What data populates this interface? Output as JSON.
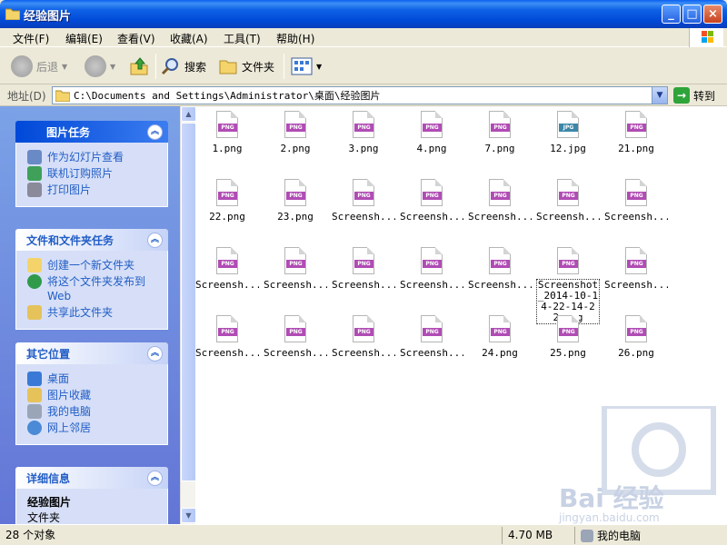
{
  "window": {
    "title": "经验图片",
    "min_label": "_",
    "max_label": "□",
    "close_label": "×"
  },
  "menu": {
    "items": [
      "文件(F)",
      "编辑(E)",
      "查看(V)",
      "收藏(A)",
      "工具(T)",
      "帮助(H)"
    ]
  },
  "toolbar": {
    "back_label": "后退",
    "search_label": "搜索",
    "folders_label": "文件夹"
  },
  "address": {
    "label": "地址(D)",
    "path": "C:\\Documents and Settings\\Administrator\\桌面\\经验图片",
    "go_label": "转到"
  },
  "sidebar": {
    "picture_tasks": {
      "title": "图片任务",
      "items": [
        "作为幻灯片查看",
        "联机订购照片",
        "打印图片"
      ]
    },
    "file_tasks": {
      "title": "文件和文件夹任务",
      "items": [
        "创建一个新文件夹",
        "将这个文件夹发布到 Web",
        "共享此文件夹"
      ]
    },
    "other_places": {
      "title": "其它位置",
      "items": [
        "桌面",
        "图片收藏",
        "我的电脑",
        "网上邻居"
      ]
    },
    "details": {
      "title": "详细信息",
      "name": "经验图片",
      "type": "文件夹"
    }
  },
  "files": [
    {
      "name": "1.png",
      "type": "PNG"
    },
    {
      "name": "2.png",
      "type": "PNG"
    },
    {
      "name": "3.png",
      "type": "PNG"
    },
    {
      "name": "4.png",
      "type": "PNG"
    },
    {
      "name": "7.png",
      "type": "PNG"
    },
    {
      "name": "12.jpg",
      "type": "JPG"
    },
    {
      "name": "21.png",
      "type": "PNG"
    },
    {
      "name": "22.png",
      "type": "PNG"
    },
    {
      "name": "23.png",
      "type": "PNG"
    },
    {
      "name": "Screensh...",
      "type": "PNG"
    },
    {
      "name": "Screensh...",
      "type": "PNG"
    },
    {
      "name": "Screensh...",
      "type": "PNG"
    },
    {
      "name": "Screensh...",
      "type": "PNG"
    },
    {
      "name": "Screensh...",
      "type": "PNG"
    },
    {
      "name": "Screensh...",
      "type": "PNG"
    },
    {
      "name": "Screensh...",
      "type": "PNG"
    },
    {
      "name": "Screensh...",
      "type": "PNG"
    },
    {
      "name": "Screensh...",
      "type": "PNG"
    },
    {
      "name": "Screensh...",
      "type": "PNG"
    },
    {
      "name": "Screenshot_2014-10-14-22-14-22.png",
      "type": "PNG"
    },
    {
      "name": "Screensh...",
      "type": "PNG"
    },
    {
      "name": "Screensh...",
      "type": "PNG"
    },
    {
      "name": "Screensh...",
      "type": "PNG"
    },
    {
      "name": "Screensh...",
      "type": "PNG"
    },
    {
      "name": "Screensh...",
      "type": "PNG"
    },
    {
      "name": "24.png",
      "type": "PNG"
    },
    {
      "name": "25.png",
      "type": "PNG"
    },
    {
      "name": "26.png",
      "type": "PNG"
    }
  ],
  "status": {
    "count": "28 个对象",
    "size": "4.70 MB",
    "location": "我的电脑"
  },
  "watermark": {
    "text": "Bai 经验",
    "sub": "jingyan.baidu.com"
  }
}
